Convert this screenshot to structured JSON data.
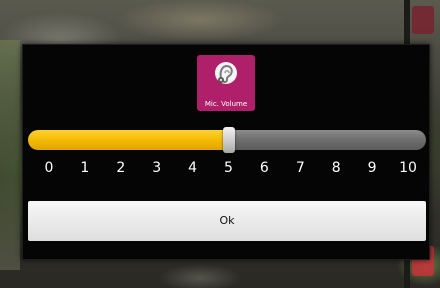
{
  "dialog": {
    "app_icon": {
      "name": "microphone-ear-icon",
      "label": "Mic. Volume",
      "color": "#b0206a"
    },
    "slider": {
      "min": 0,
      "max": 10,
      "value": 5,
      "fill_color": "#f2b800",
      "track_color": "#7a7a7a"
    },
    "ticks": [
      "0",
      "1",
      "2",
      "3",
      "4",
      "5",
      "6",
      "7",
      "8",
      "9",
      "10"
    ],
    "ok_label": "Ok"
  }
}
